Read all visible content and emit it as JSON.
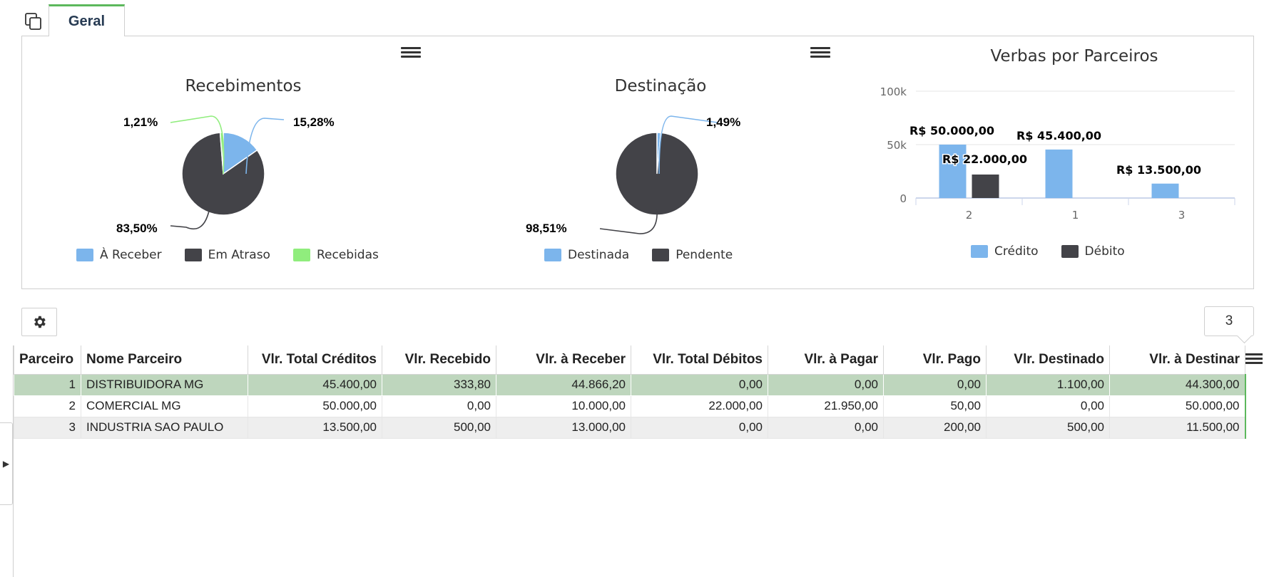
{
  "tab": {
    "label": "Geral"
  },
  "charts": {
    "recebimentos": {
      "title": "Recebimentos",
      "labels": {
        "areceber": "15,28%",
        "ematraso": "83,50%",
        "recebidas": "1,21%"
      },
      "legend": [
        "À Receber",
        "Em Atraso",
        "Recebidas"
      ]
    },
    "destinacao": {
      "title": "Destinação",
      "labels": {
        "destinada": "1,49%",
        "pendente": "98,51%"
      },
      "legend": [
        "Destinada",
        "Pendente"
      ]
    },
    "verbas": {
      "title": "Verbas por Parceiros",
      "legend": [
        "Crédito",
        "Débito"
      ],
      "y_ticks": [
        "0",
        "50k",
        "100k"
      ]
    }
  },
  "chart_data": [
    {
      "type": "pie",
      "title": "Recebimentos",
      "categories": [
        "À Receber",
        "Em Atraso",
        "Recebidas"
      ],
      "values": [
        15.28,
        83.5,
        1.21
      ],
      "colors": [
        "#7cb5ec",
        "#434348",
        "#90ed7d"
      ]
    },
    {
      "type": "pie",
      "title": "Destinação",
      "categories": [
        "Destinada",
        "Pendente"
      ],
      "values": [
        1.49,
        98.51
      ],
      "colors": [
        "#7cb5ec",
        "#434348"
      ]
    },
    {
      "type": "bar",
      "title": "Verbas por Parceiros",
      "categories": [
        "2",
        "1",
        "3"
      ],
      "ylim": [
        0,
        100000
      ],
      "y_ticks": [
        0,
        50000,
        100000
      ],
      "series": [
        {
          "name": "Crédito",
          "color": "#7cb5ec",
          "values": [
            50000,
            45400,
            13500
          ],
          "labels": [
            "R$ 50.000,00",
            "R$ 45.400,00",
            "R$ 13.500,00"
          ]
        },
        {
          "name": "Débito",
          "color": "#434348",
          "values": [
            22000,
            0,
            0
          ],
          "labels": [
            "R$ 22.000,00",
            "",
            ""
          ]
        }
      ]
    }
  ],
  "toolbar": {
    "record_count": "3"
  },
  "table": {
    "headers": [
      "Parceiro",
      "Nome Parceiro",
      "Vlr. Total Créditos",
      "Vlr. Recebido",
      "Vlr. à Receber",
      "Vlr. Total Débitos",
      "Vlr. à Pagar",
      "Vlr. Pago",
      "Vlr. Destinado",
      "Vlr. à Destinar"
    ],
    "rows": [
      [
        "1",
        "DISTRIBUIDORA MG",
        "45.400,00",
        "333,80",
        "44.866,20",
        "0,00",
        "0,00",
        "0,00",
        "1.100,00",
        "44.300,00"
      ],
      [
        "2",
        "COMERCIAL MG",
        "50.000,00",
        "0,00",
        "10.000,00",
        "22.000,00",
        "21.950,00",
        "50,00",
        "0,00",
        "50.000,00"
      ],
      [
        "3",
        "INDUSTRIA SAO PAULO",
        "13.500,00",
        "500,00",
        "13.000,00",
        "0,00",
        "0,00",
        "200,00",
        "500,00",
        "11.500,00"
      ]
    ],
    "selected_row": 0
  },
  "colors": {
    "accent": "#5cb85c",
    "credit": "#7cb5ec",
    "debit": "#434348",
    "received": "#90ed7d",
    "selected_row": "#bed6bd"
  },
  "icons": {
    "copy": "copy-icon",
    "menu": "hamburger-icon",
    "settings": "gear-icon",
    "expand": "triangle-right-icon"
  }
}
